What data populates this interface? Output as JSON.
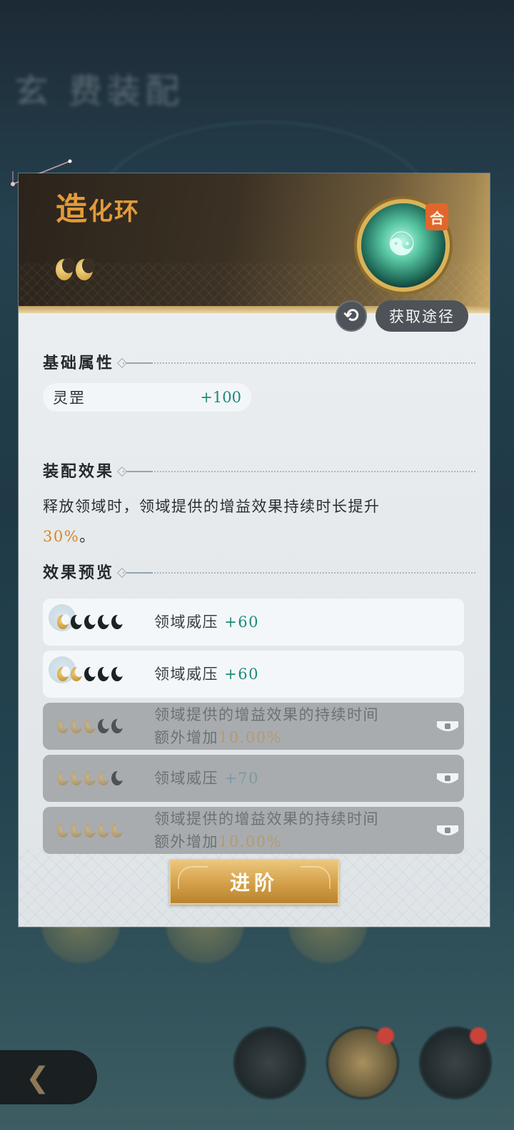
{
  "background": {
    "title": "玄 费装配"
  },
  "item": {
    "name_first": "造",
    "name_rest": "化环",
    "badge": "合",
    "star_count": 2
  },
  "actions": {
    "refresh_icon": "refresh-icon",
    "source_label": "获取途径"
  },
  "base_attributes": {
    "title": "基础属性",
    "name": "灵罡",
    "value": "+100"
  },
  "equip_effect": {
    "title": "装配效果",
    "text_before": "释放领域时，领域提供的增益效果持续时长提升",
    "highlight": "30%",
    "text_after": "。"
  },
  "preview": {
    "title": "效果预览",
    "rows": [
      {
        "stars": 1,
        "label": "领域威压",
        "value": "+60",
        "locked": false
      },
      {
        "stars": 2,
        "label": "领域威压",
        "value": "+60",
        "locked": false
      },
      {
        "stars": 3,
        "line1": "领域提供的增益效果的持续时间",
        "line2_prefix": "额外增加",
        "value": "10.00%",
        "locked": true
      },
      {
        "stars": 4,
        "label": "领域威压",
        "value": "+70",
        "locked": true
      },
      {
        "stars": 5,
        "line1": "领域提供的增益效果的持续时间",
        "line2_prefix": "额外增加",
        "value": "10.00%",
        "locked": true
      }
    ]
  },
  "advance_button": "进阶",
  "colors": {
    "accent_gold": "#e39a3a",
    "value_teal": "#1d8a7a",
    "highlight_orange": "#d88626"
  }
}
